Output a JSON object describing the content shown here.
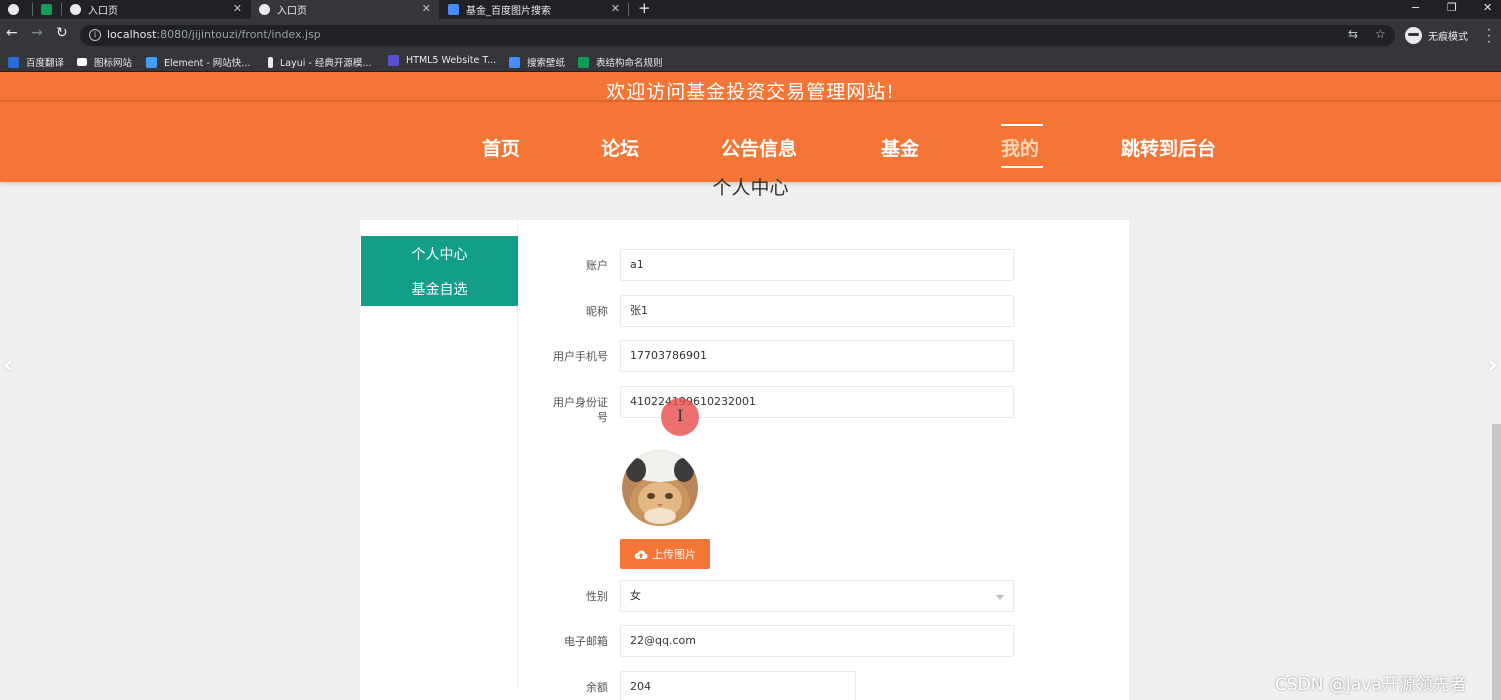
{
  "browser": {
    "tabs": [
      {
        "label": ""
      },
      {
        "label": ""
      },
      {
        "label": "入口页"
      },
      {
        "label": "入口页"
      },
      {
        "label": "基金_百度图片搜索"
      }
    ],
    "new_tab": "+",
    "url_host": "localhost",
    "url_path": ":8080/jijintouzi/front/index.jsp",
    "incognito_label": "无痕模式",
    "bookmarks": [
      {
        "label": "百度翻译",
        "color": "#2b6cd6"
      },
      {
        "label": "图标网站",
        "color": "#ffffff"
      },
      {
        "label": "Element - 网站快...",
        "color": "#409eff"
      },
      {
        "label": "Layui - 经典开源模...",
        "color": "#e8eaed"
      },
      {
        "label": "HTML5 Website T...",
        "color": "#5a4fcf"
      },
      {
        "label": "搜索壁纸",
        "color": "#4a8cff"
      },
      {
        "label": "表结构命名规则",
        "color": "#0f9d58"
      }
    ]
  },
  "site": {
    "welcome": "欢迎访问基金投资交易管理网站!",
    "nav": [
      "首页",
      "论坛",
      "公告信息",
      "基金",
      "我的",
      "跳转到后台"
    ],
    "active_nav": "我的",
    "brand_color": "#f47636",
    "accent_color": "#129e88"
  },
  "profile": {
    "page_title": "个人中心",
    "sidebar": [
      "个人中心",
      "基金自选"
    ],
    "fields": {
      "account": {
        "label": "账户",
        "value": "a1"
      },
      "nickname": {
        "label": "昵称",
        "value": "张1"
      },
      "phone": {
        "label": "用户手机号",
        "value": "17703786901"
      },
      "id_card": {
        "label": "用户身份证号",
        "value": "410224199610232001"
      },
      "gender": {
        "label": "性别",
        "value": "女"
      },
      "email": {
        "label": "电子邮箱",
        "value": "22@qq.com"
      },
      "balance": {
        "label": "余额",
        "value": "204"
      }
    },
    "upload_label": "上传图片"
  },
  "watermark": "CSDN @Java开源领先者"
}
